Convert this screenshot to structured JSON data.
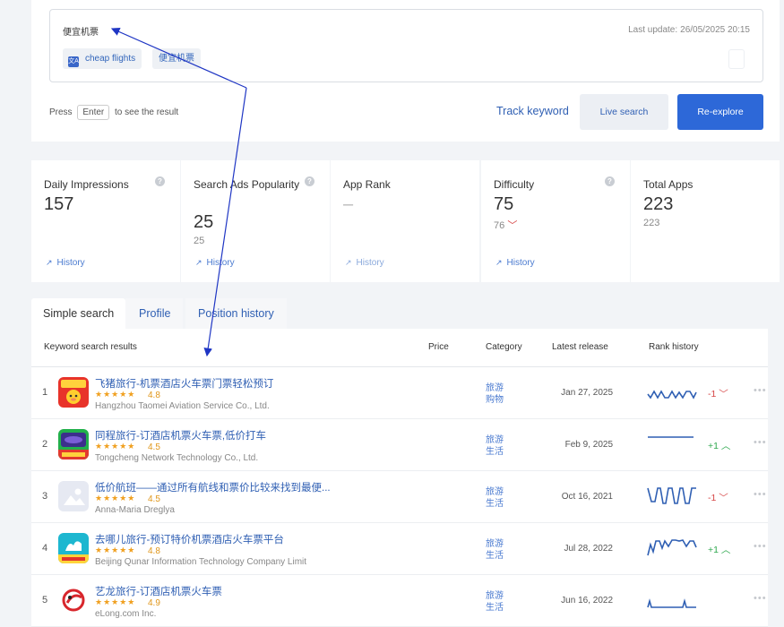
{
  "search": {
    "query": "便宜机票",
    "last_update_label": "Last update:",
    "last_update_value": "26/05/2025 20:15",
    "translation_chip": "cheap flights",
    "original_chip": "便宜机票",
    "translate_icon": "translate-icon",
    "hint_prefix": "Press",
    "hint_key": "Enter",
    "hint_suffix": "to see the result",
    "track_keyword": "Track keyword",
    "live_search": "Live search",
    "re_explore": "Re-explore"
  },
  "metrics": [
    {
      "label": "Daily Impressions",
      "value": "157",
      "sub": "",
      "history": "History"
    },
    {
      "label": "Search Ads Popularity",
      "value": "25",
      "sub": "25",
      "history": "History"
    },
    {
      "label": "App Rank",
      "value": "–",
      "sub": "",
      "history": "History"
    },
    {
      "label": "Difficulty",
      "value": "75",
      "sub": "76",
      "history": "History"
    },
    {
      "label": "Total Apps",
      "value": "223",
      "sub": "223",
      "history": ""
    }
  ],
  "tabs": {
    "simple": "Simple search",
    "profile": "Profile",
    "position": "Position history"
  },
  "table": {
    "header": {
      "results": "Keyword search results",
      "price": "Price",
      "category": "Category",
      "latest": "Latest release",
      "rank": "Rank history"
    },
    "rows": [
      {
        "num": "1",
        "name": "飞猪旅行-机票酒店火车票门票轻松预订",
        "stars": "★★★★★",
        "rating": "4.8",
        "dev": "Hangzhou Taomei Aviation Service Co., Ltd.",
        "cat1": "旅游",
        "cat2": "购物",
        "release": "Jan 27, 2025",
        "delta": "-1",
        "trend": "down",
        "more": "•••"
      },
      {
        "num": "2",
        "name": "同程旅行-订酒店机票火车票,低价打车",
        "stars": "★★★★★",
        "rating": "4.5",
        "dev": "Tongcheng Network Technology Co., Ltd.",
        "cat1": "旅游",
        "cat2": "生活",
        "release": "Feb 9, 2025",
        "delta": "+1",
        "trend": "up",
        "more": "•••"
      },
      {
        "num": "3",
        "name": "低价航班——通过所有航线和票价比较来找到最便...",
        "stars": "★★★★★",
        "rating": "4.5",
        "dev": "Anna-Maria Dreglya",
        "cat1": "旅游",
        "cat2": "生活",
        "release": "Oct 16, 2021",
        "delta": "-1",
        "trend": "down",
        "more": "•••"
      },
      {
        "num": "4",
        "name": "去哪儿旅行-预订特价机票酒店火车票平台",
        "stars": "★★★★★",
        "rating": "4.8",
        "dev": "Beijing Qunar Information Technology Company Limit",
        "cat1": "旅游",
        "cat2": "生活",
        "release": "Jul 28, 2022",
        "delta": "+1",
        "trend": "up",
        "more": "•••"
      },
      {
        "num": "5",
        "name": "艺龙旅行-订酒店机票火车票",
        "stars": "★★★★★",
        "rating": "4.9",
        "dev": "eLong.com Inc.",
        "cat1": "旅游",
        "cat2": "生活",
        "release": "Jun 16, 2022",
        "delta": "",
        "trend": "",
        "more": "•••"
      }
    ]
  },
  "colors": {
    "accent": "#2d68d8",
    "link": "#2f5fb3",
    "rank_down": "#d64545",
    "rank_up": "#2fa84f",
    "annotation_arrow": "#1f36c4"
  }
}
